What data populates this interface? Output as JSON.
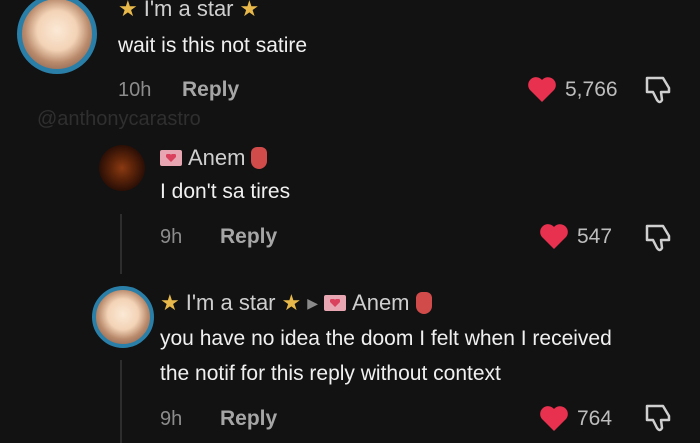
{
  "comments": [
    {
      "username": "I'm a star",
      "text": "wait is this not satire",
      "time": "10h",
      "reply_label": "Reply",
      "likes": "5,766"
    },
    {
      "username": "Anem",
      "text": "I don't sa tires",
      "time": "9h",
      "reply_label": "Reply",
      "likes": "547"
    },
    {
      "username": "I'm a star",
      "reply_to": "Anem",
      "text_line1": "you have no idea the doom I felt when I received",
      "text_line2": "the notif for this reply without context",
      "time": "9h",
      "reply_label": "Reply",
      "likes": "764"
    }
  ],
  "watermark": "@anthonycarastro",
  "colors": {
    "background": "#121212",
    "heart": "#e8304f",
    "avatar_ring": "#2a7fa8",
    "star": "#e8b94a"
  },
  "icons": [
    "star-icon",
    "heart-icon",
    "dislike-icon",
    "mail-heart-icon",
    "hand-icon",
    "reply-arrow-icon"
  ]
}
